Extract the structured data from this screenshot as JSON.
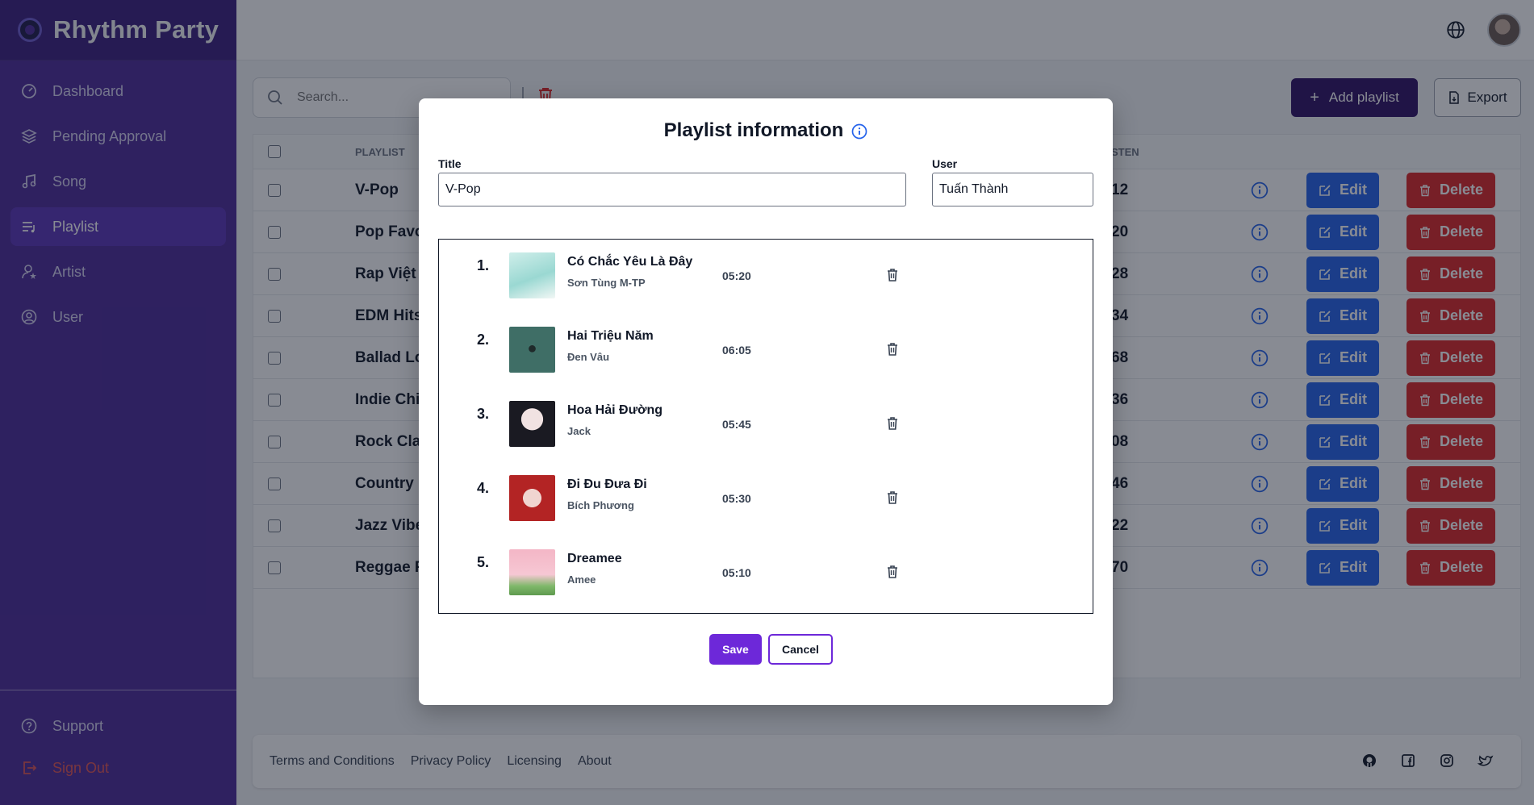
{
  "app": {
    "name": "Rhythm Party"
  },
  "sidebar": {
    "items": [
      {
        "label": "Dashboard",
        "icon": "gauge-icon"
      },
      {
        "label": "Pending Approval",
        "icon": "layers-icon"
      },
      {
        "label": "Song",
        "icon": "music-note-icon"
      },
      {
        "label": "Playlist",
        "icon": "playlist-icon",
        "active": true
      },
      {
        "label": "Artist",
        "icon": "artist-icon"
      },
      {
        "label": "User",
        "icon": "user-circle-icon"
      }
    ],
    "support": "Support",
    "signout": "Sign Out"
  },
  "toolbar": {
    "search_placeholder": "Search...",
    "add_label": "Add playlist",
    "export_label": "Export"
  },
  "table": {
    "headers": {
      "playlist": "PLAYLIST",
      "listen": "STEN"
    },
    "edit_label": "Edit",
    "delete_label": "Delete",
    "rows": [
      {
        "title": "V-Pop",
        "listen": "12"
      },
      {
        "title": "Pop Favor",
        "listen": "20"
      },
      {
        "title": "Rap Việt",
        "listen": "28"
      },
      {
        "title": "EDM Hits",
        "listen": "34"
      },
      {
        "title": "Ballad Lov",
        "listen": "68"
      },
      {
        "title": "Indie Chill",
        "listen": "36"
      },
      {
        "title": "Rock Clas",
        "listen": "08"
      },
      {
        "title": "Country R",
        "listen": "46"
      },
      {
        "title": "Jazz Vibe",
        "listen": "22"
      },
      {
        "title": "Reggae R",
        "listen": "70"
      }
    ]
  },
  "footer": {
    "links": [
      "Terms and Conditions",
      "Privacy Policy",
      "Licensing",
      "About"
    ],
    "socials": [
      "github-icon",
      "facebook-icon",
      "instagram-icon",
      "twitter-icon"
    ]
  },
  "modal": {
    "title": "Playlist information",
    "title_label": "Title",
    "title_value": "V-Pop",
    "user_label": "User",
    "user_value": "Tuấn Thành",
    "songs": [
      {
        "num": "1.",
        "name": "Có Chắc Yêu Là Đây",
        "artist": "Sơn Tùng M-TP",
        "duration": "05:20"
      },
      {
        "num": "2.",
        "name": "Hai Triệu Năm",
        "artist": "Đen Vâu",
        "duration": "06:05"
      },
      {
        "num": "3.",
        "name": "Hoa Hải Đường",
        "artist": "Jack",
        "duration": "05:45"
      },
      {
        "num": "4.",
        "name": "Đi Đu Đưa Đi",
        "artist": "Bích Phương",
        "duration": "05:30"
      },
      {
        "num": "5.",
        "name": "Dreamee",
        "artist": "Amee",
        "duration": "05:10"
      }
    ],
    "save_label": "Save",
    "cancel_label": "Cancel"
  },
  "colors": {
    "sidebar": "#4c2a99",
    "accent": "#6d28d9",
    "edit": "#2563eb",
    "delete": "#dc2626",
    "add_button": "#2e1065"
  }
}
